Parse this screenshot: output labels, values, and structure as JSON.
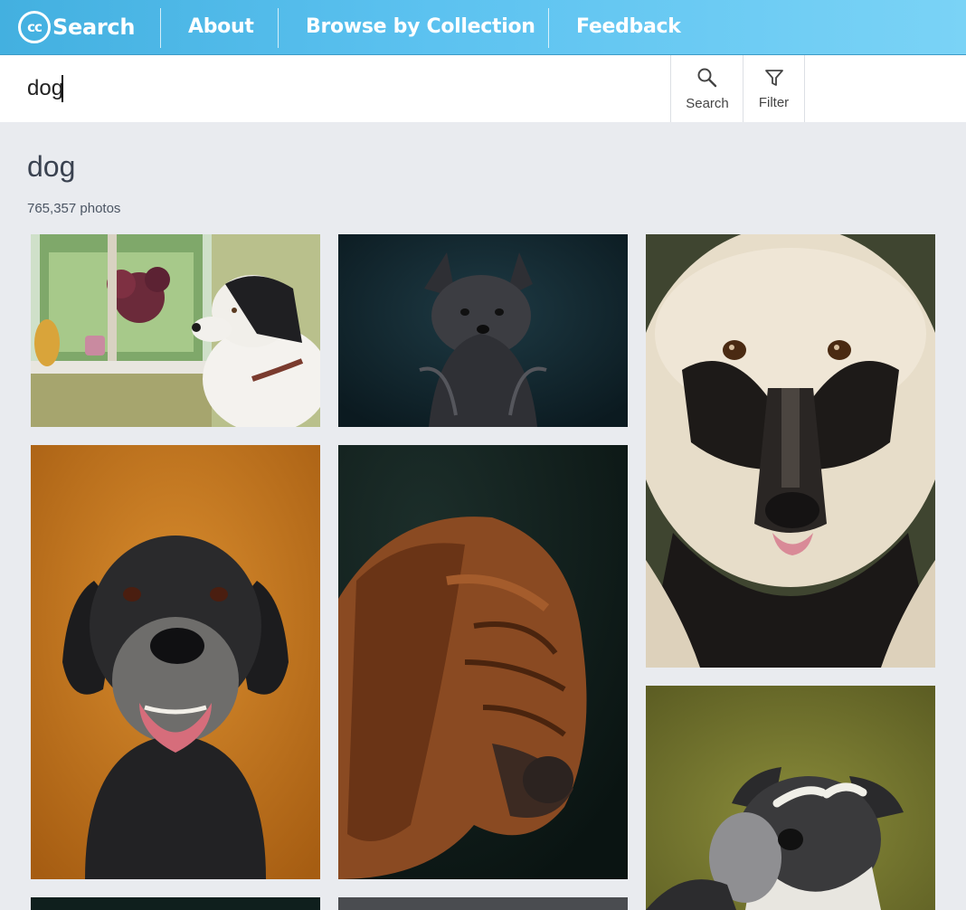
{
  "header": {
    "logo_mark": "cc",
    "logo_text": "Search",
    "nav": [
      "About",
      "Browse by Collection",
      "Feedback"
    ],
    "colors": {
      "bar_start": "#43b0e0",
      "bar_end": "#7ad3f6"
    }
  },
  "search": {
    "value": "dog",
    "search_label": "Search",
    "filter_label": "Filter",
    "search_icon": "magnifier-icon",
    "filter_icon": "funnel-icon"
  },
  "results": {
    "title": "dog",
    "count": "765,357 photos"
  },
  "photos": [
    {
      "subject": "border collie at window with plants"
    },
    {
      "subject": "small long-haired dog on dark background"
    },
    {
      "subject": "shaggy cream and black dog portrait"
    },
    {
      "subject": "black labrador with grey muzzle on orange background"
    },
    {
      "subject": "bloodhound profile on dark background"
    },
    {
      "subject": "schnauzer with raised paw on olive background"
    },
    {
      "subject": "photo thumbnail (dark)"
    },
    {
      "subject": "photo thumbnail (grey)"
    }
  ]
}
